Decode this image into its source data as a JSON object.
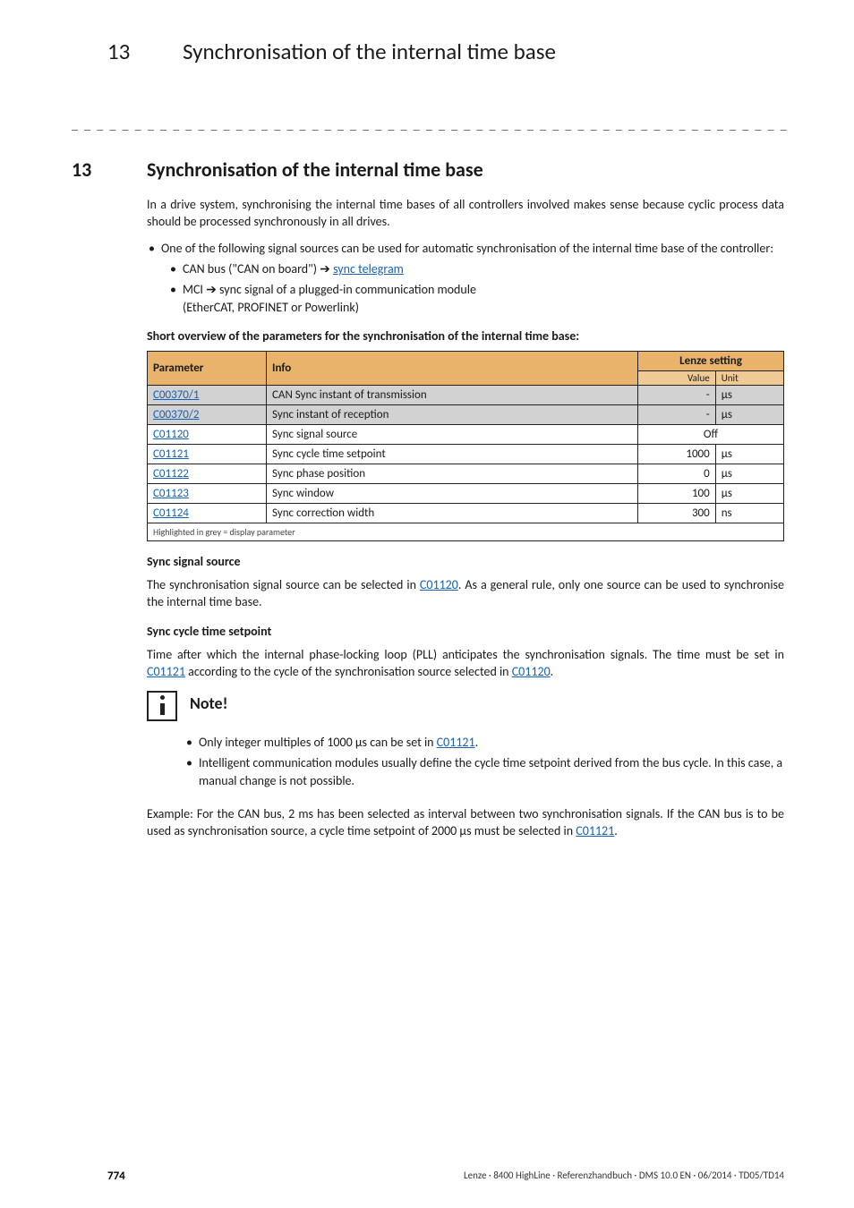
{
  "running_head": {
    "num": "13",
    "title": "Synchronisation of the internal time base"
  },
  "rule": "_ _ _ _ _ _ _ _ _ _ _ _ _ _ _ _ _ _ _ _ _ _ _ _ _ _ _ _ _ _ _ _ _ _ _ _ _ _ _ _ _ _ _ _ _ _ _ _ _ _ _ _ _ _ _ _ _ _ _ _ _ _ _ _",
  "section": {
    "num": "13",
    "title": "Synchronisation of the internal time base"
  },
  "intro": "In a drive system, synchronising the internal time bases of all controllers involved makes sense because cyclic process data should be processed synchronously in all drives.",
  "bullet1": "One of the following signal sources can be used for automatic synchronisation of the internal time base of the controller:",
  "sub1_pre": "CAN bus (\"CAN on board\") ",
  "sub1_link": "sync telegram",
  "sub2_pre": "MCI ",
  "sub2_post": " sync signal of a plugged-in communication module",
  "sub2_line2": "(EtherCAT, PROFINET or Powerlink)",
  "overview_head": "Short overview of the parameters for the synchronisation of the internal time base:",
  "table": {
    "head": {
      "param": "Parameter",
      "info": "Info",
      "lenze": "Lenze setting",
      "value": "Value",
      "unit": "Unit"
    },
    "rows": [
      {
        "param": "C00370/1",
        "info": "CAN Sync instant of transmission",
        "value": "-",
        "unit": "µs",
        "grey": true,
        "off": false
      },
      {
        "param": "C00370/2",
        "info": "Sync instant of reception",
        "value": "-",
        "unit": "µs",
        "grey": true,
        "off": false
      },
      {
        "param": "C01120",
        "info": "Sync signal source",
        "value": "Off",
        "unit": "",
        "grey": false,
        "off": true
      },
      {
        "param": "C01121",
        "info": "Sync cycle time setpoint",
        "value": "1000",
        "unit": "µs",
        "grey": false,
        "off": false
      },
      {
        "param": "C01122",
        "info": "Sync phase position",
        "value": "0",
        "unit": "µs",
        "grey": false,
        "off": false
      },
      {
        "param": "C01123",
        "info": "Sync window",
        "value": "100",
        "unit": "µs",
        "grey": false,
        "off": false
      },
      {
        "param": "C01124",
        "info": "Sync correction width",
        "value": "300",
        "unit": "ns",
        "grey": false,
        "off": false
      }
    ],
    "footnote": "Highlighted in grey = display parameter"
  },
  "sync_source_head": "Sync signal source",
  "sync_source_p_a": "The synchronisation signal source can be selected in ",
  "sync_source_link": "C01120",
  "sync_source_p_b": ". As a general rule, only one source can be used to synchronise the internal time base.",
  "setpoint_head": "Sync cycle time setpoint",
  "setpoint_p_a": "Time after which the internal phase-locking loop (PLL) anticipates the synchronisation signals. The time must be set in ",
  "setpoint_link1": "C01121",
  "setpoint_p_b": " according to the cycle of the synchronisation source selected in ",
  "setpoint_link2": "C01120",
  "setpoint_p_c": ".",
  "note_label": "Note!",
  "note1_a": "Only integer multiples of 1000 µs can be set in ",
  "note1_link": "C01121",
  "note1_b": ".",
  "note2": "Intelligent communication modules usually define the cycle time setpoint derived from the bus cycle. In this case, a manual change is not possible.",
  "example_a": "Example: For the CAN bus, 2 ms has been selected as interval between two synchronisation signals. If the CAN bus is to be used as synchronisation source, a cycle time setpoint of 2000 µs must be selected in ",
  "example_link": "C01121",
  "example_b": ".",
  "footer": {
    "page": "774",
    "meta": "Lenze · 8400 HighLine · Referenzhandbuch · DMS 10.0 EN · 06/2014 · TD05/TD14"
  }
}
